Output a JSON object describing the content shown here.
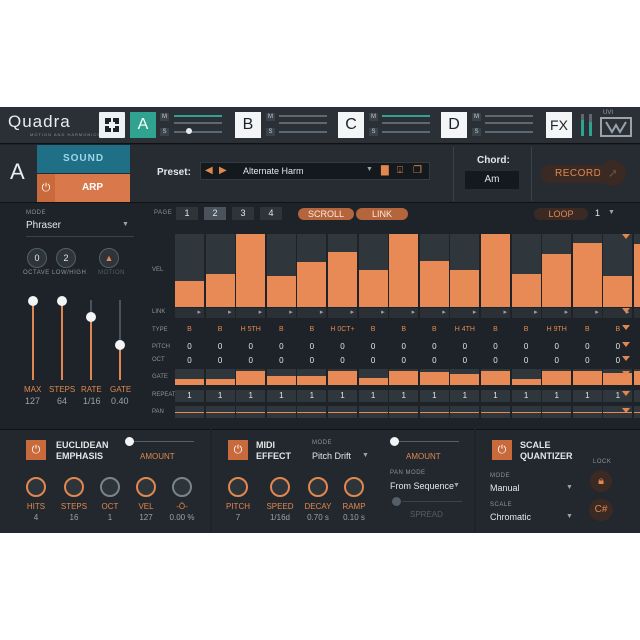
{
  "header": {
    "logo": "Quadra",
    "logo_sub": "MOTION AND HARMONICS",
    "slots": [
      {
        "label": "A",
        "selected": true
      },
      {
        "label": "B",
        "selected": false
      },
      {
        "label": "C",
        "selected": false
      },
      {
        "label": "D",
        "selected": false
      },
      {
        "label": "FX",
        "selected": false
      }
    ],
    "ms_m": "M",
    "ms_s": "S",
    "brand": "UVI"
  },
  "toolbar": {
    "layer": "A",
    "tab_sound": "SOUND",
    "tab_arp": "ARP",
    "preset_label": "Preset:",
    "preset_value": "Alternate Harm",
    "chord_label": "Chord:",
    "chord_value": "Am",
    "record": "RECORD"
  },
  "arp": {
    "mode_label": "MODE",
    "mode_value": "Phraser",
    "oct_low": "0",
    "oct_high": "2",
    "oct_label": "OCTAVE LOW/HIGH",
    "motion_label": "MOTION",
    "sliders": [
      {
        "label": "MAX",
        "value": "127",
        "level": 1.0
      },
      {
        "label": "STEPS",
        "value": "64",
        "level": 1.0
      },
      {
        "label": "RATE",
        "value": "1/16",
        "level": 0.8
      },
      {
        "label": "GATE",
        "value": "0.40",
        "level": 0.45
      }
    ]
  },
  "grid": {
    "page_label": "PAGE",
    "pages": [
      "1",
      "2",
      "3",
      "4"
    ],
    "selected_page": "2",
    "scroll": "SCROLL",
    "link": "LINK",
    "loop": "LOOP",
    "loop_value": "1",
    "row_labels": {
      "vel": "VEL",
      "link": "LINK",
      "type": "TYPE",
      "pitch": "PITCH",
      "oct": "OCT",
      "gate": "GATE",
      "repeat": "REPEAT",
      "pan": "PAN"
    },
    "velocity": [
      0.35,
      0.45,
      1.0,
      0.42,
      0.62,
      0.75,
      0.5,
      1.0,
      0.63,
      0.5,
      1.0,
      0.45,
      0.73,
      0.87,
      0.43,
      0.86
    ],
    "types": [
      "B",
      "B",
      "H 5TH",
      "B",
      "B",
      "H 0CT+",
      "B",
      "B",
      "B",
      "H 4TH",
      "B",
      "B",
      "H 9TH",
      "B",
      "B",
      "B"
    ],
    "pitch": [
      "0",
      "0",
      "0",
      "0",
      "0",
      "0",
      "0",
      "0",
      "0",
      "0",
      "0",
      "0",
      "0",
      "0",
      "0",
      "0"
    ],
    "oct": [
      "0",
      "0",
      "0",
      "0",
      "0",
      "0",
      "0",
      "0",
      "0",
      "0",
      "0",
      "0",
      "0",
      "0",
      "0",
      "0"
    ],
    "gate": [
      0.4,
      0.4,
      0.9,
      0.55,
      0.55,
      0.9,
      0.45,
      0.9,
      0.8,
      0.7,
      0.9,
      0.35,
      0.85,
      0.85,
      0.75,
      0.85
    ],
    "repeat": [
      "1",
      "1",
      "1",
      "1",
      "1",
      "1",
      "1",
      "1",
      "1",
      "1",
      "1",
      "1",
      "1",
      "1",
      "1",
      "1"
    ]
  },
  "euclid": {
    "title1": "EUCLIDEAN",
    "title2": "EMPHASIS",
    "amount": "AMOUNT",
    "knobs": [
      {
        "label": "HITS",
        "value": "4"
      },
      {
        "label": "STEPS",
        "value": "16"
      },
      {
        "label": "OCT",
        "value": "1"
      },
      {
        "label": "VEL",
        "value": "127"
      },
      {
        "label": "-Ö-",
        "value": "0.00 %"
      }
    ]
  },
  "midi": {
    "title1": "MIDI",
    "title2": "EFFECT",
    "mode_label": "MODE",
    "mode_value": "Pitch Drift",
    "amount": "AMOUNT",
    "pan_mode_label": "PAN MODE",
    "pan_mode_value": "From Sequence",
    "spread": "SPREAD",
    "knobs": [
      {
        "label": "PITCH",
        "value": "7"
      },
      {
        "label": "SPEED",
        "value": "1/16d"
      },
      {
        "label": "DECAY",
        "value": "0.70 s"
      },
      {
        "label": "RAMP",
        "value": "0.10 s"
      }
    ]
  },
  "scale": {
    "title1": "SCALE",
    "title2": "QUANTIZER",
    "mode_label": "MODE",
    "mode_value": "Manual",
    "scale_label": "SCALE",
    "scale_value": "Chromatic",
    "lock_label": "LOCK",
    "key": "C#"
  }
}
